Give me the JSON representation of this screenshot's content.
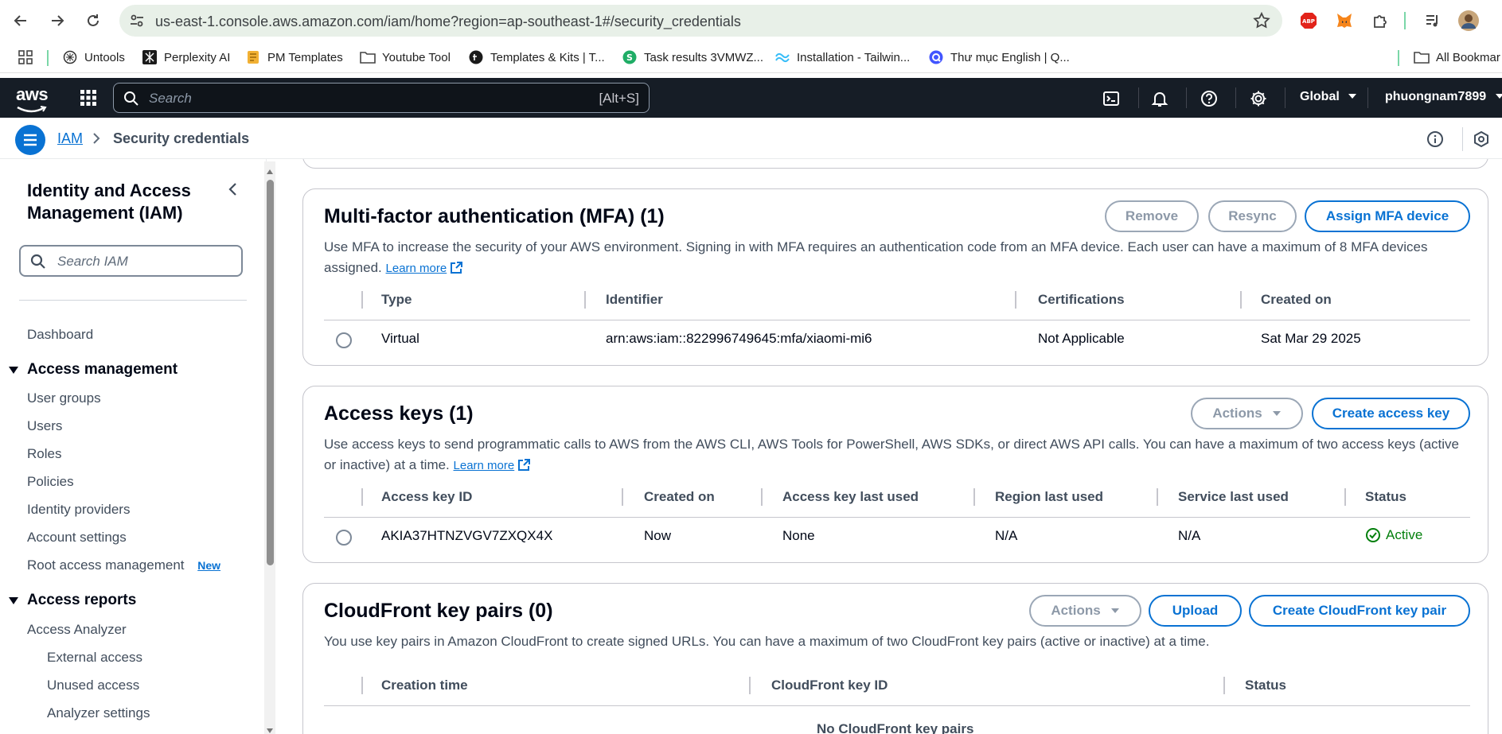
{
  "browser": {
    "url": "us-east-1.console.aws.amazon.com/iam/home?region=ap-southeast-1#/security_credentials",
    "bookmarks": [
      {
        "label": "Untools"
      },
      {
        "label": "Perplexity AI"
      },
      {
        "label": "PM Templates"
      },
      {
        "label": "Youtube Tool"
      },
      {
        "label": "Templates & Kits | T..."
      },
      {
        "label": "Task results 3VMWZ..."
      },
      {
        "label": "Installation - Tailwin..."
      },
      {
        "label": "Thư mục English | Q..."
      }
    ],
    "all_bookmarks": "All Bookmar"
  },
  "aws_nav": {
    "logo": "aws",
    "search_placeholder": "Search",
    "search_shortcut": "[Alt+S]",
    "region": "Global",
    "account": "phuongnam7899"
  },
  "breadcrumb": {
    "root": "IAM",
    "current": "Security credentials"
  },
  "sidebar": {
    "title": "Identity and Access Management (IAM)",
    "search_placeholder": "Search IAM",
    "dashboard": "Dashboard",
    "access_management": {
      "heading": "Access management",
      "items": [
        "User groups",
        "Users",
        "Roles",
        "Policies",
        "Identity providers",
        "Account settings",
        "Root access management"
      ],
      "new_badge": "New"
    },
    "access_reports": {
      "heading": "Access reports",
      "item": "Access Analyzer",
      "sub_items": [
        "External access",
        "Unused access",
        "Analyzer settings"
      ]
    }
  },
  "mfa": {
    "title": "Multi-factor authentication (MFA) (1)",
    "description": "Use MFA to increase the security of your AWS environment. Signing in with MFA requires an authentication code from an MFA device. Each user can have a maximum of 8 MFA devices assigned.",
    "learn_more": "Learn more",
    "buttons": {
      "remove": "Remove",
      "resync": "Resync",
      "assign": "Assign MFA device"
    },
    "columns": [
      "Type",
      "Identifier",
      "Certifications",
      "Created on"
    ],
    "row": {
      "type": "Virtual",
      "identifier": "arn:aws:iam::822996749645:mfa/xiaomi-mi6",
      "certifications": "Not Applicable",
      "created_on": "Sat Mar 29 2025"
    }
  },
  "access_keys": {
    "title": "Access keys (1)",
    "description": "Use access keys to send programmatic calls to AWS from the AWS CLI, AWS Tools for PowerShell, AWS SDKs, or direct AWS API calls. You can have a maximum of two access keys (active or inactive) at a time.",
    "learn_more": "Learn more",
    "buttons": {
      "actions": "Actions",
      "create": "Create access key"
    },
    "columns": [
      "Access key ID",
      "Created on",
      "Access key last used",
      "Region last used",
      "Service last used",
      "Status"
    ],
    "row": {
      "id": "AKIA37HTNZVGV7ZXQX4X",
      "created_on": "Now",
      "last_used": "None",
      "region": "N/A",
      "service": "N/A",
      "status": "Active"
    }
  },
  "cloudfront": {
    "title": "CloudFront key pairs (0)",
    "description": "You use key pairs in Amazon CloudFront to create signed URLs. You can have a maximum of two CloudFront key pairs (active or inactive) at a time.",
    "buttons": {
      "actions": "Actions",
      "upload": "Upload",
      "create": "Create CloudFront key pair"
    },
    "columns": [
      "Creation time",
      "CloudFront key ID",
      "Status"
    ],
    "empty": "No CloudFront key pairs"
  },
  "colors": {
    "accent": "#0972d3",
    "nav_bg": "#161d26",
    "success": "#037f0c"
  }
}
